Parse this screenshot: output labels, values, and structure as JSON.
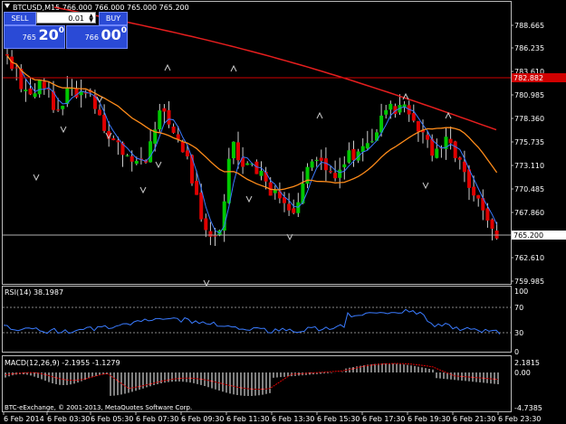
{
  "header": {
    "symbol_line": "BTCUSD,M15  766.000 766.000 765.000 765.200"
  },
  "trade_panel": {
    "sell_label": "SELL",
    "buy_label": "BUY",
    "lot_value": "0.01",
    "sell_price_small": "765",
    "sell_price_big": "20",
    "sell_price_sup": "0",
    "buy_price_small": "766",
    "buy_price_big": "00",
    "buy_price_sup": "0"
  },
  "colors": {
    "background": "#000000",
    "bull_candle": "#00c800",
    "bear_candle": "#e00000",
    "ma_fast": "#3a7bff",
    "ma_mid": "#ff8c1a",
    "ma_slow": "#e61e1e",
    "hline": "#d00000",
    "current_price_line": "#b0b0b0",
    "rsi": "#3a7bff",
    "macd_signal": "#e00000",
    "macd_hist": "#ffffff",
    "panel_button": "#2a4ad6"
  },
  "price_axis": {
    "ticks": [
      "788.665",
      "786.235",
      "783.610",
      "780.985",
      "778.360",
      "775.735",
      "773.110",
      "770.485",
      "767.860",
      "765.200",
      "762.610",
      "759.985"
    ],
    "red_label": "782.882",
    "current_label": "765.200"
  },
  "rsi_panel": {
    "label": "RSI(14) 38.1987",
    "levels": [
      "100",
      "70",
      "30",
      "0"
    ]
  },
  "macd_panel": {
    "label": "MACD(12,26,9) -2.1955 -1.1279",
    "levels": [
      "2.1815",
      "0.00",
      "-4.7385"
    ]
  },
  "time_axis": {
    "labels": [
      "6 Feb 2014",
      "6 Feb 03:30",
      "6 Feb 05:30",
      "6 Feb 07:30",
      "6 Feb 09:30",
      "6 Feb 11:30",
      "6 Feb 13:30",
      "6 Feb 15:30",
      "6 Feb 17:30",
      "6 Feb 19:30",
      "6 Feb 21:30",
      "6 Feb 23:30"
    ]
  },
  "footer": {
    "copyright": "BTC-eExchange, © 2001-2013, MetaQuotes Software Corp."
  }
}
